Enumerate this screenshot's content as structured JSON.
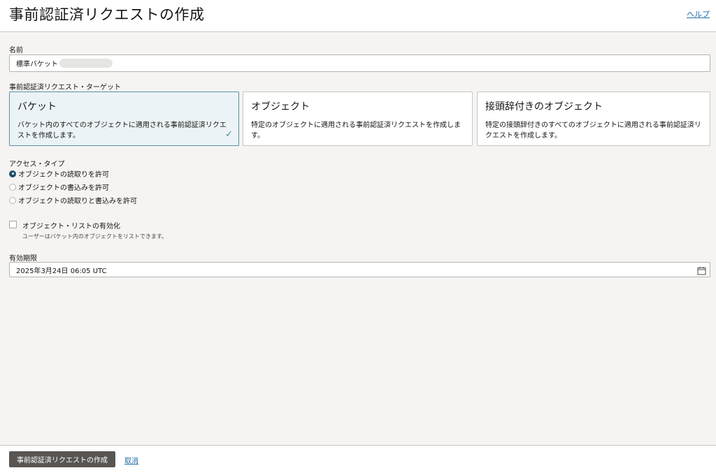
{
  "header": {
    "title": "事前認証済リクエストの作成",
    "help_label": "ヘルプ"
  },
  "form": {
    "name_label": "名前",
    "name_value": "標準バケット",
    "target_label": "事前認証済リクエスト・ターゲット",
    "targets": [
      {
        "title": "バケット",
        "description": "バケット内のすべてのオブジェクトに適用される事前認証済リクエストを作成します。",
        "selected": true
      },
      {
        "title": "オブジェクト",
        "description": "特定のオブジェクトに適用される事前認証済リクエストを作成します。",
        "selected": false
      },
      {
        "title": "接頭辞付きのオブジェクト",
        "description": "特定の接頭辞付きのすべてのオブジェクトに適用される事前認証済リクエストを作成します。",
        "selected": false
      }
    ],
    "access_type_label": "アクセス・タイプ",
    "access_options": [
      {
        "label": "オブジェクトの読取りを許可",
        "checked": true
      },
      {
        "label": "オブジェクトの書込みを許可",
        "checked": false
      },
      {
        "label": "オブジェクトの読取りと書込みを許可",
        "checked": false
      }
    ],
    "object_listing_label": "オブジェクト・リストの有効化",
    "object_listing_checked": false,
    "object_listing_hint": "ユーザーはバケット内のオブジェクトをリストできます。",
    "expiration_label": "有効期限",
    "expiration_value": "2025年3月24日 06:05 UTC"
  },
  "footer": {
    "create_label": "事前認証済リクエストの作成",
    "cancel_label": "取消"
  },
  "icons": {
    "check": "check-icon",
    "calendar": "calendar-icon"
  },
  "colors": {
    "accent": "#1f6fa8",
    "selected_tile_bg": "#ecf3f6",
    "primary_button": "#595552"
  }
}
